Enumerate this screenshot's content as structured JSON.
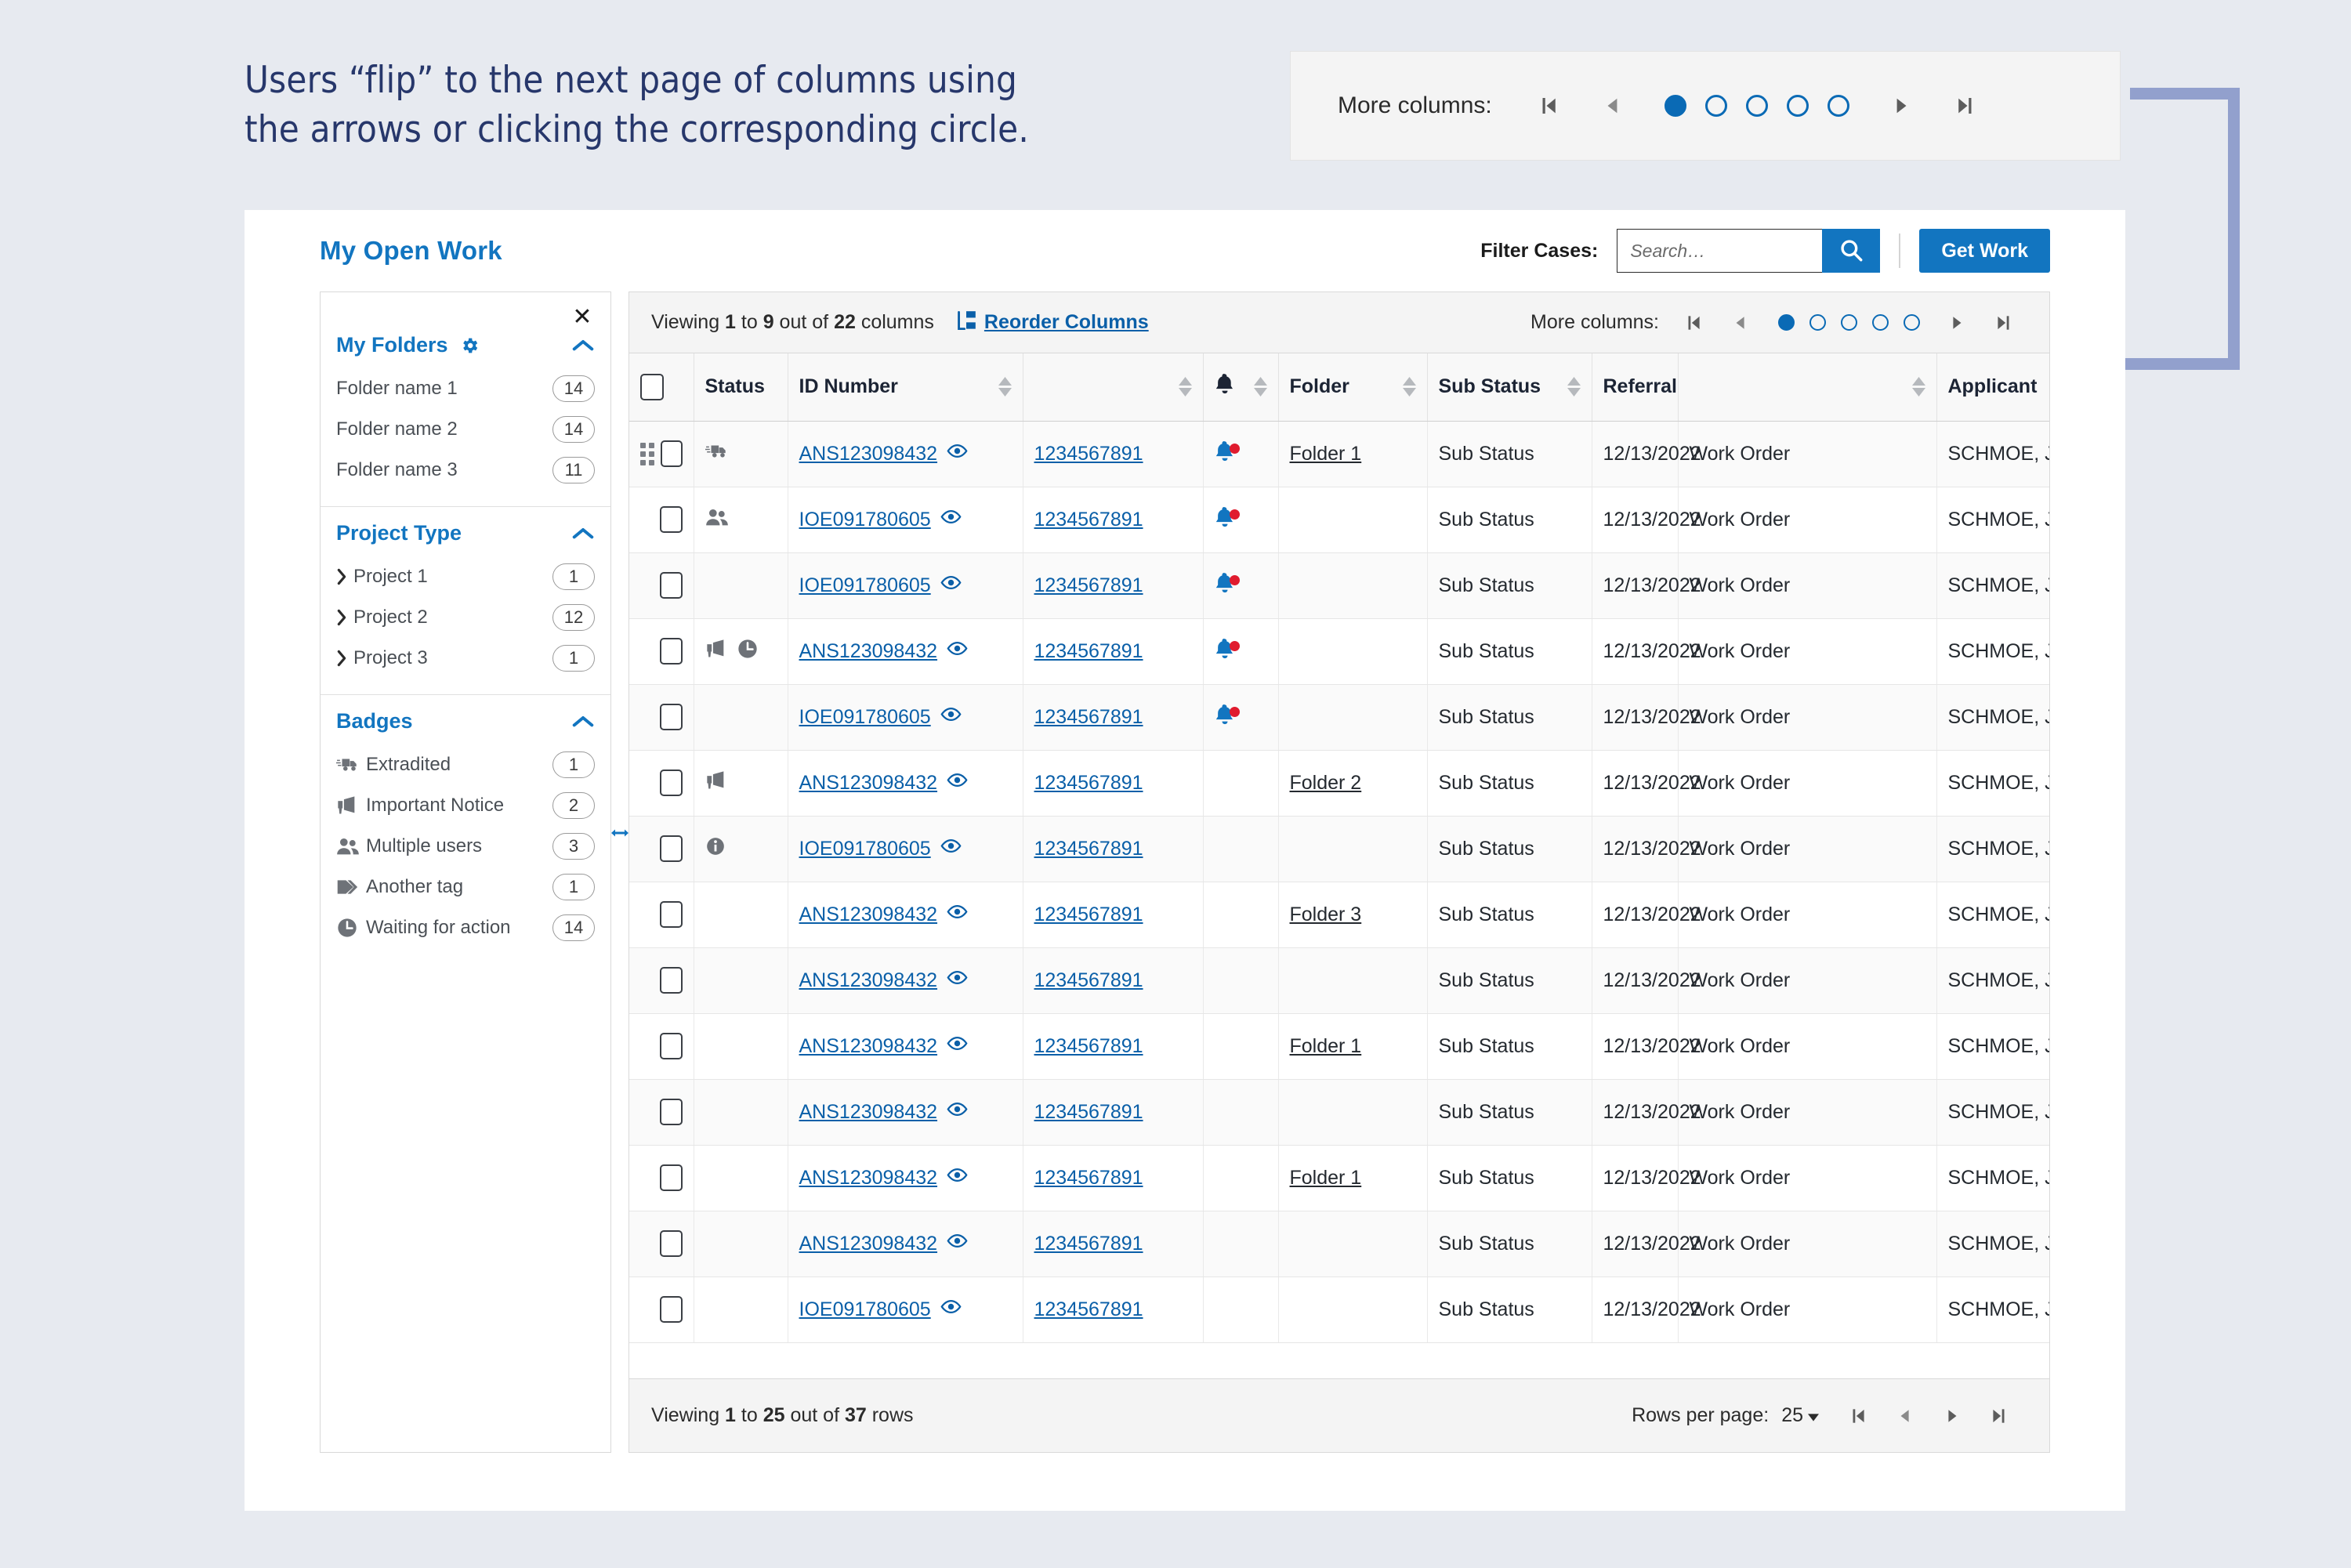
{
  "annotation": {
    "line1": "Users “flip” to the next page of columns using",
    "line2": "the arrows or clicking the corresponding circle."
  },
  "callout": {
    "label": "More columns:",
    "first_icon": "first-page-icon",
    "prev_icon": "prev-page-icon",
    "next_icon": "next-page-icon",
    "last_icon": "last-page-icon",
    "dots": 5,
    "active_dot": 1,
    "accent": "#0a6ab5"
  },
  "app": {
    "title": "My Open Work",
    "header": {
      "filter_label": "Filter Cases:",
      "search_placeholder": "Search…",
      "search_value": "",
      "search_icon": "search-icon",
      "get_work_label": "Get Work",
      "accent": "#1275c0"
    }
  },
  "sidebar": {
    "close_icon": "close-icon",
    "sections": [
      {
        "title": "My Folders",
        "gear_icon": "gear-icon",
        "chevron_icon": "chevron-up-icon",
        "has_gear": true,
        "items": [
          {
            "label": "Folder name 1",
            "count": "14"
          },
          {
            "label": "Folder name 2",
            "count": "14"
          },
          {
            "label": "Folder name 3",
            "count": "11"
          }
        ]
      },
      {
        "title": "Project Type",
        "chevron_icon": "chevron-up-icon",
        "has_gear": false,
        "items": [
          {
            "label": "Project 1",
            "count": "1",
            "caret": "chevron-right-icon"
          },
          {
            "label": "Project 2",
            "count": "12",
            "caret": "chevron-right-icon"
          },
          {
            "label": "Project 3",
            "count": "1",
            "caret": "chevron-right-icon"
          }
        ]
      },
      {
        "title": "Badges",
        "chevron_icon": "chevron-up-icon",
        "has_gear": false,
        "items": [
          {
            "label": "Extradited",
            "count": "1",
            "icon": "truck-icon"
          },
          {
            "label": "Important Notice",
            "count": "2",
            "icon": "megaphone-icon"
          },
          {
            "label": "Multiple users",
            "count": "3",
            "icon": "users-icon"
          },
          {
            "label": "Another tag",
            "count": "1",
            "icon": "tag-icon"
          },
          {
            "label": "Waiting for action",
            "count": "14",
            "icon": "clock-icon"
          }
        ]
      }
    ],
    "resize_handle_icon": "horizontal-resize-icon"
  },
  "table_toolbar": {
    "viewing_prefix": "Viewing ",
    "viewing_from": "1",
    "viewing_mid": " to ",
    "viewing_to": "9",
    "viewing_of": " out of ",
    "viewing_total": "22",
    "viewing_suffix": " columns",
    "reorder_label": "Reorder Columns",
    "reorder_icon": "reorder-columns-icon",
    "more_columns_label": "More columns:",
    "dots": 5,
    "active_dot": 1
  },
  "grid": {
    "select_all_checkbox": "",
    "columns": [
      {
        "key": "handle",
        "label": "",
        "sortable": false
      },
      {
        "key": "status",
        "label": "Status",
        "sortable": false
      },
      {
        "key": "id",
        "label": "ID Number",
        "sortable": true
      },
      {
        "key": "num",
        "label": "",
        "sortable": true
      },
      {
        "key": "bell",
        "label": "",
        "icon": "bell-icon",
        "sortable": true
      },
      {
        "key": "folder",
        "label": "Folder",
        "sortable": true
      },
      {
        "key": "sub",
        "label": "Sub Status",
        "sortable": true
      },
      {
        "key": "ref",
        "label": "Referral",
        "sortable": false
      },
      {
        "key": "wo",
        "label": "",
        "sortable": true
      },
      {
        "key": "app",
        "label": "Applicant",
        "sortable": true
      }
    ],
    "rows": [
      {
        "drag": true,
        "status_icons": [
          "truck-icon"
        ],
        "id": "ANS123098432",
        "eye": "eye-icon",
        "num": "1234567891",
        "bell": true,
        "folder": "Folder 1",
        "sub": "Sub Status",
        "ref": "12/13/2022",
        "wo": "Work Order",
        "app": "SCHMOE, JOE MOE"
      },
      {
        "drag": false,
        "status_icons": [
          "users-icon"
        ],
        "id": "IOE091780605",
        "eye": "eye-icon",
        "num": "1234567891",
        "bell": true,
        "folder": "",
        "sub": "Sub Status",
        "ref": "12/13/2022",
        "wo": "Work Order",
        "app": "SCHMOE, JOE MOE"
      },
      {
        "drag": false,
        "status_icons": [],
        "id": "IOE091780605",
        "eye": "eye-icon",
        "num": "1234567891",
        "bell": true,
        "folder": "",
        "sub": "Sub Status",
        "ref": "12/13/2022",
        "wo": "Work Order",
        "app": "SCHMOE, JOE MOE"
      },
      {
        "drag": false,
        "status_icons": [
          "megaphone-icon",
          "clock-icon"
        ],
        "id": "ANS123098432",
        "eye": "eye-icon",
        "num": "1234567891",
        "bell": true,
        "folder": "",
        "sub": "Sub Status",
        "ref": "12/13/2022",
        "wo": "Work Order",
        "app": "SCHMOE, JOE MOE"
      },
      {
        "drag": false,
        "status_icons": [],
        "id": "IOE091780605",
        "eye": "eye-icon",
        "num": "1234567891",
        "bell": true,
        "folder": "",
        "sub": "Sub Status",
        "ref": "12/13/2022",
        "wo": "Work Order",
        "app": "SCHMOE, JOE MOE"
      },
      {
        "drag": false,
        "status_icons": [
          "megaphone-icon"
        ],
        "id": "ANS123098432",
        "eye": "eye-icon",
        "num": "1234567891",
        "bell": false,
        "folder": "Folder 2",
        "sub": "Sub Status",
        "ref": "12/13/2022",
        "wo": "Work Order",
        "app": "SCHMOE, JOE MOE"
      },
      {
        "drag": false,
        "status_icons": [
          "info-icon"
        ],
        "id": "IOE091780605",
        "eye": "eye-icon",
        "num": "1234567891",
        "bell": false,
        "folder": "",
        "sub": "Sub Status",
        "ref": "12/13/2022",
        "wo": "Work Order",
        "app": "SCHMOE, JOE MOE"
      },
      {
        "drag": false,
        "status_icons": [],
        "id": "ANS123098432",
        "eye": "eye-icon",
        "num": "1234567891",
        "bell": false,
        "folder": "Folder 3",
        "sub": "Sub Status",
        "ref": "12/13/2022",
        "wo": "Work Order",
        "app": "SCHMOE, JOE MOE"
      },
      {
        "drag": false,
        "status_icons": [],
        "id": "ANS123098432",
        "eye": "eye-icon",
        "num": "1234567891",
        "bell": false,
        "folder": "",
        "sub": "Sub Status",
        "ref": "12/13/2022",
        "wo": "Work Order",
        "app": "SCHMOE, JOE MOE"
      },
      {
        "drag": false,
        "status_icons": [],
        "id": "ANS123098432",
        "eye": "eye-icon",
        "num": "1234567891",
        "bell": false,
        "folder": "Folder 1",
        "sub": "Sub Status",
        "ref": "12/13/2022",
        "wo": "Work Order",
        "app": "SCHMOE, JOE MOE"
      },
      {
        "drag": false,
        "status_icons": [],
        "id": "ANS123098432",
        "eye": "eye-icon",
        "num": "1234567891",
        "bell": false,
        "folder": "",
        "sub": "Sub Status",
        "ref": "12/13/2022",
        "wo": "Work Order",
        "app": "SCHMOE, JOE MOE"
      },
      {
        "drag": false,
        "status_icons": [],
        "id": "ANS123098432",
        "eye": "eye-icon",
        "num": "1234567891",
        "bell": false,
        "folder": "Folder 1",
        "sub": "Sub Status",
        "ref": "12/13/2022",
        "wo": "Work Order",
        "app": "SCHMOE, JOE MOE"
      },
      {
        "drag": false,
        "status_icons": [],
        "id": "ANS123098432",
        "eye": "eye-icon",
        "num": "1234567891",
        "bell": false,
        "folder": "",
        "sub": "Sub Status",
        "ref": "12/13/2022",
        "wo": "Work Order",
        "app": "SCHMOE, JOE MOE"
      },
      {
        "drag": false,
        "status_icons": [],
        "id": "IOE091780605",
        "eye": "eye-icon",
        "num": "1234567891",
        "bell": false,
        "folder": "",
        "sub": "Sub Status",
        "ref": "12/13/2022",
        "wo": "Work Order",
        "app": "SCHMOE, JOE MOE"
      }
    ]
  },
  "table_footer": {
    "viewing_prefix": "Viewing ",
    "viewing_from": "1",
    "viewing_mid": " to ",
    "viewing_to": "25",
    "viewing_of": " out of ",
    "viewing_total": "37",
    "viewing_suffix": " rows",
    "rows_per_page_label": "Rows per page:",
    "rows_per_page_value": "25",
    "first_icon": "first-page-icon",
    "prev_icon": "prev-page-icon",
    "next_icon": "next-page-icon",
    "last_icon": "last-page-icon"
  }
}
